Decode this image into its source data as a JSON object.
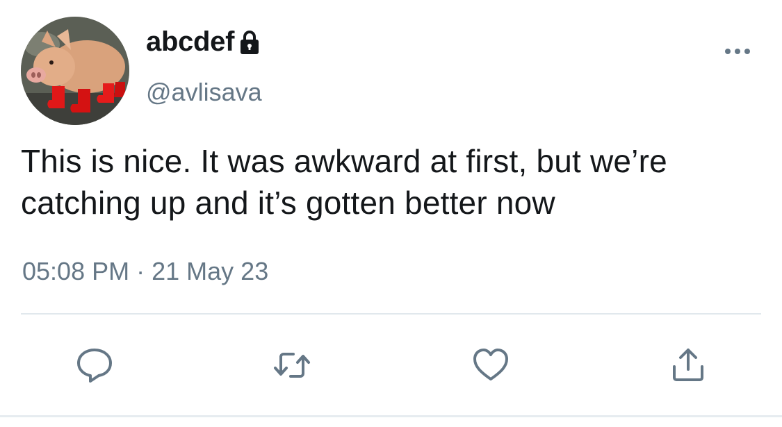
{
  "user": {
    "display_name": "abcdef",
    "handle": "@avlisava",
    "protected": true,
    "avatar_icon": "pig-in-red-boots"
  },
  "tweet": {
    "text": "This is nice. It was awkward at first, but we’re catching up and it’s gotten better now",
    "time": "05:08 PM",
    "separator": "·",
    "date": "21 May 23"
  },
  "actions": [
    {
      "name": "reply-icon"
    },
    {
      "name": "retweet-icon"
    },
    {
      "name": "like-icon"
    },
    {
      "name": "share-icon"
    }
  ],
  "colors": {
    "text": "#14171a",
    "secondary": "#657786",
    "divider": "#e1e8ed"
  }
}
